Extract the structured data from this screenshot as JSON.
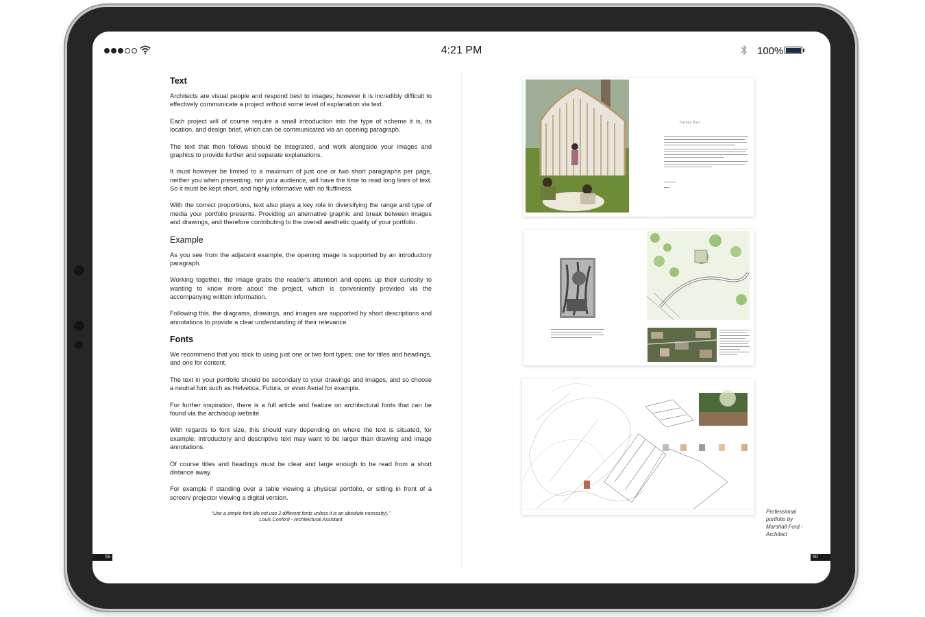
{
  "status_bar": {
    "time": "4:21 PM",
    "battery_percent": "100%",
    "signal_bars_filled": 3,
    "signal_bars_total": 5,
    "battery_level": 1.0
  },
  "icons": {
    "signal": "signal-dots-icon",
    "wifi": "wifi-icon",
    "bluetooth": "bluetooth-icon",
    "battery": "battery-icon"
  },
  "colors": {
    "bezel": "#262626",
    "battery_fill": "#1b2a4a",
    "text": "#222222"
  },
  "left_page": {
    "sections": [
      {
        "heading": "Text",
        "paragraphs": [
          "Architects are visual people and respond best to images; however it is incredibly difficult to effectively communicate a project without some level of explanation via text.",
          "Each project will of course require a small introduction into the type of scheme it is, its location, and design brief, which can be communicated via an opening paragraph.",
          "The text that then follows should be integrated, and work alongside your images and graphics to provide further and separate explanations.",
          "It must however be limited to a maximum of just one or two short paragraphs per page, neither you when presenting, nor your audience, will have the time to read long lines of text. So it must be kept short, and highly informative with no fluffiness.",
          "With the correct proportions, text also plays a key role in diversifying the range and type of media your portfolio presents. Providing an alternative graphic and break between images and drawings, and therefore contributing to the overall aesthetic quality of your portfolio."
        ]
      },
      {
        "heading": "Example",
        "paragraphs": [
          "As you see from the adjacent example, the opening image is supported by an introductory paragraph.",
          "Working together, the image grabs the reader’s attention and opens up their curiosity to wanting to know more about the project, which is conveniently provided via the accompanying written information.",
          "Following this, the diagrams, drawings, and images are supported by short descriptions and annotations to provide a clear understanding of their relevance."
        ]
      },
      {
        "heading": "Fonts",
        "paragraphs": [
          "We recommend that you stick to using just one or two font types; one for titles and headings, and one for content.",
          "The text in your portfolio should be secondary to your drawings and images, and so choose a neutral font such as Helvetica, Futura, or even Aerial for example.",
          "For further inspiration, there is a full article and feature on architectural fonts that can be found via the archisoup website.",
          "With regards to font size, this should vary depending on where the text is situated, for example; introductory and descriptive text may want to be larger than drawing and image annotations.",
          "Of course titles and headings must be clear and large enough to be read from a short distance away.",
          "For example if standing over a table viewing a physical portfolio, or sitting in front of a screen/ projector viewing a digital version."
        ]
      }
    ],
    "quote": "“Use a simple font (do not use 2 different fonts unless it is an absolute necessity).”",
    "quote_author": "Louis Conforti - Architectural Assistant",
    "page_number": "59"
  },
  "right_page": {
    "sample_title": "Garden Pavi",
    "caption_lines": [
      "Professional",
      "portfolio by",
      "Marshall Ford -",
      "Architect"
    ],
    "page_number": "60"
  }
}
